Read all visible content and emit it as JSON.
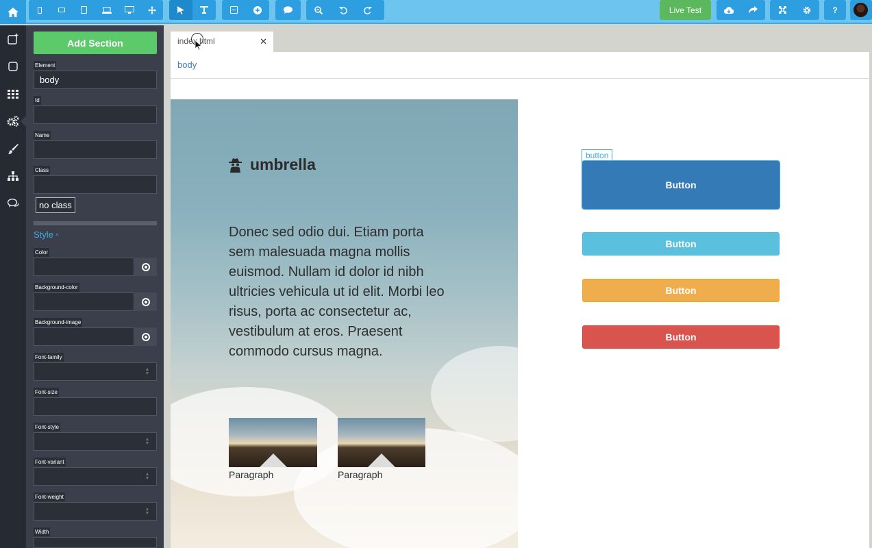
{
  "toolbar": {
    "live_test": "Live Test",
    "device_icons": [
      "mobile-portrait-icon",
      "mobile-landscape-icon",
      "tablet-icon",
      "laptop-icon",
      "desktop-icon",
      "expand-arrows-icon"
    ],
    "tool_icons": [
      "pointer-icon",
      "text-tool-icon"
    ],
    "action_icons": [
      "section-icon",
      "add-icon",
      "comment-icon",
      "zoom-out-icon",
      "undo-icon",
      "redo-icon"
    ]
  },
  "rail": {
    "items": [
      "add-element-icon",
      "square-icon",
      "grid-icon",
      "settings-gears-icon",
      "brush-icon",
      "sitemap-icon",
      "chat-icon"
    ]
  },
  "panel": {
    "add_section": "Add Section",
    "labels": {
      "element": "Element",
      "id": "Id",
      "name": "Name",
      "class": "Class",
      "color": "Color",
      "background_color": "Background-color",
      "background_image": "Background-image",
      "font_family": "Font-family",
      "font_size": "Font-size",
      "font_style": "Font-style",
      "font_variant": "Font-variant",
      "font_weight": "Font-weight",
      "width": "Width"
    },
    "values": {
      "element": "body",
      "id": "",
      "name": "",
      "class": ""
    },
    "no_class": "no class",
    "style_heading": "Style"
  },
  "editor": {
    "tab_name": "index.html",
    "breadcrumb": "body"
  },
  "page": {
    "brand": "umbrella",
    "hero_text": "Donec sed odio dui. Etiam porta sem malesuada magna mollis euismod. Nullam id dolor id nibh ultricies vehicula ut id elit. Morbi leo risus, porta ac consectetur ac, vestibulum at eros. Praesent commodo cursus magna.",
    "thumbs": [
      {
        "caption": "Paragraph"
      },
      {
        "caption": "Paragraph"
      }
    ],
    "selected_tag": "button",
    "buttons": [
      {
        "label": "Button",
        "variant": "primary",
        "color": "#337ab7"
      },
      {
        "label": "Button",
        "variant": "info",
        "color": "#5bc0de"
      },
      {
        "label": "Button",
        "variant": "warning",
        "color": "#f0ad4e"
      },
      {
        "label": "Button",
        "variant": "danger",
        "color": "#d9534f"
      }
    ]
  },
  "colors": {
    "accent": "#2d9ee0",
    "toolbar_bg": "#6cc4ef",
    "success": "#5cb85c",
    "panel_bg": "#3a3f4b",
    "rail_bg": "#262a33"
  }
}
